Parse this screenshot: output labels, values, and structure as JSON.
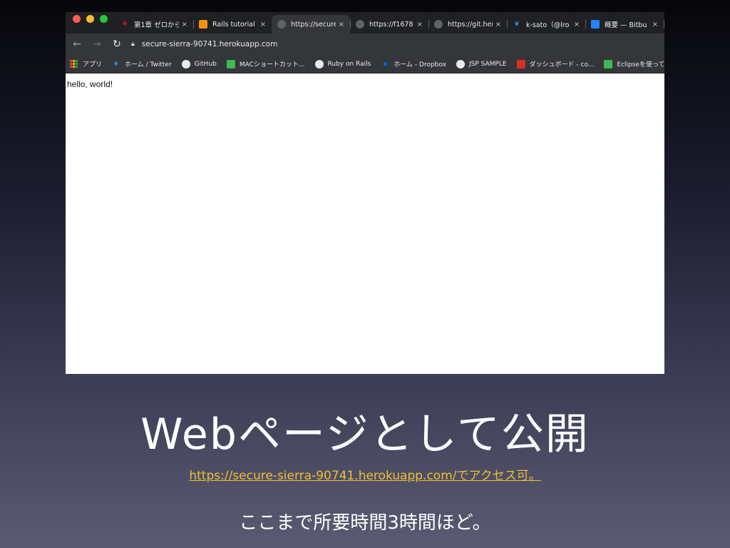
{
  "browser": {
    "tabs": [
      {
        "title": "第1章 ゼロから",
        "icon": "rails-red-icon",
        "active": false
      },
      {
        "title": "Rails tutorial",
        "icon": "cube-orange-icon",
        "active": false
      },
      {
        "title": "https://secure",
        "icon": "globe-icon",
        "active": true
      },
      {
        "title": "https://f1678",
        "icon": "globe-icon",
        "active": false
      },
      {
        "title": "https://git.her",
        "icon": "globe-icon",
        "active": false
      },
      {
        "title": "k-sato（@lro",
        "icon": "twitter-icon",
        "active": false
      },
      {
        "title": "概要 — Bitbu",
        "icon": "bitbucket-icon",
        "active": false
      }
    ],
    "close_glyph": "×",
    "address": "secure-sierra-90741.herokuapp.com",
    "bookmarks": [
      {
        "label": "アプリ",
        "icon": "apps-grid-icon"
      },
      {
        "label": "ホーム / Twitter",
        "icon": "twitter-icon"
      },
      {
        "label": "GitHub",
        "icon": "github-icon"
      },
      {
        "label": "MACショートカット...",
        "icon": "green-q-icon"
      },
      {
        "label": "Ruby on Rails",
        "icon": "globe-icon"
      },
      {
        "label": "ホーム - Dropbox",
        "icon": "dropbox-icon"
      },
      {
        "label": "JSP SAMPLE",
        "icon": "globe-icon"
      },
      {
        "label": "ダッシュボード - co...",
        "icon": "red-c-icon"
      },
      {
        "label": "Eclipseを使ってTo",
        "icon": "green-q-icon"
      }
    ],
    "page_text": "hello, world!"
  },
  "slide": {
    "title": "Webページとして公開",
    "link": "https://secure-sierra-90741.herokuapp.com/でアクセス可。",
    "note": "ここまで所要時間3時間ほど。"
  },
  "colors": {
    "tab_bg": "#202124",
    "toolbar_bg": "#35363a",
    "link_color": "#f0c030"
  }
}
